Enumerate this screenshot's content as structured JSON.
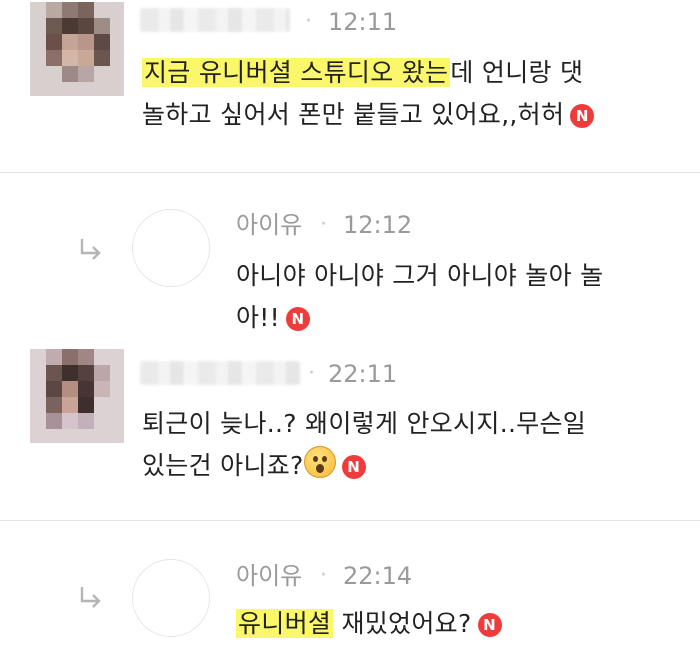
{
  "comments": [
    {
      "author": "",
      "time": "12:11",
      "text_highlight": "지금 유니버셜 스튜디오 왔는",
      "text_rest_line1": "데 언니랑 댓",
      "text_line2": "놀하고 싶어서 폰만 붙들고 있어요,,허허",
      "badge": "N"
    },
    {
      "author": "아이유",
      "time": "12:12",
      "text_line1": "아니야 아니야 그거 아니야 놀아 놀",
      "text_line2": "아!!",
      "badge": "N",
      "is_reply": true
    },
    {
      "author": "",
      "time": "22:11",
      "text_line1": "퇴근이 늦나..? 왜이렇게 안오시지..무슨일",
      "text_line2": "있는건 아니죠?",
      "badge": "N",
      "emoji": "astonished-face"
    },
    {
      "author": "아이유",
      "time": "22:14",
      "text_highlight": "유니버셜",
      "text_rest": " 재밌었어요?",
      "badge": "N",
      "is_reply": true
    }
  ],
  "separator": "·",
  "colors": {
    "highlight": "#fbf76a",
    "badge": "#ef3b3b",
    "meta_text": "#9a9a9a"
  },
  "icons": {
    "reply": "reply-arrow-icon",
    "new_badge": "new-badge-icon"
  }
}
